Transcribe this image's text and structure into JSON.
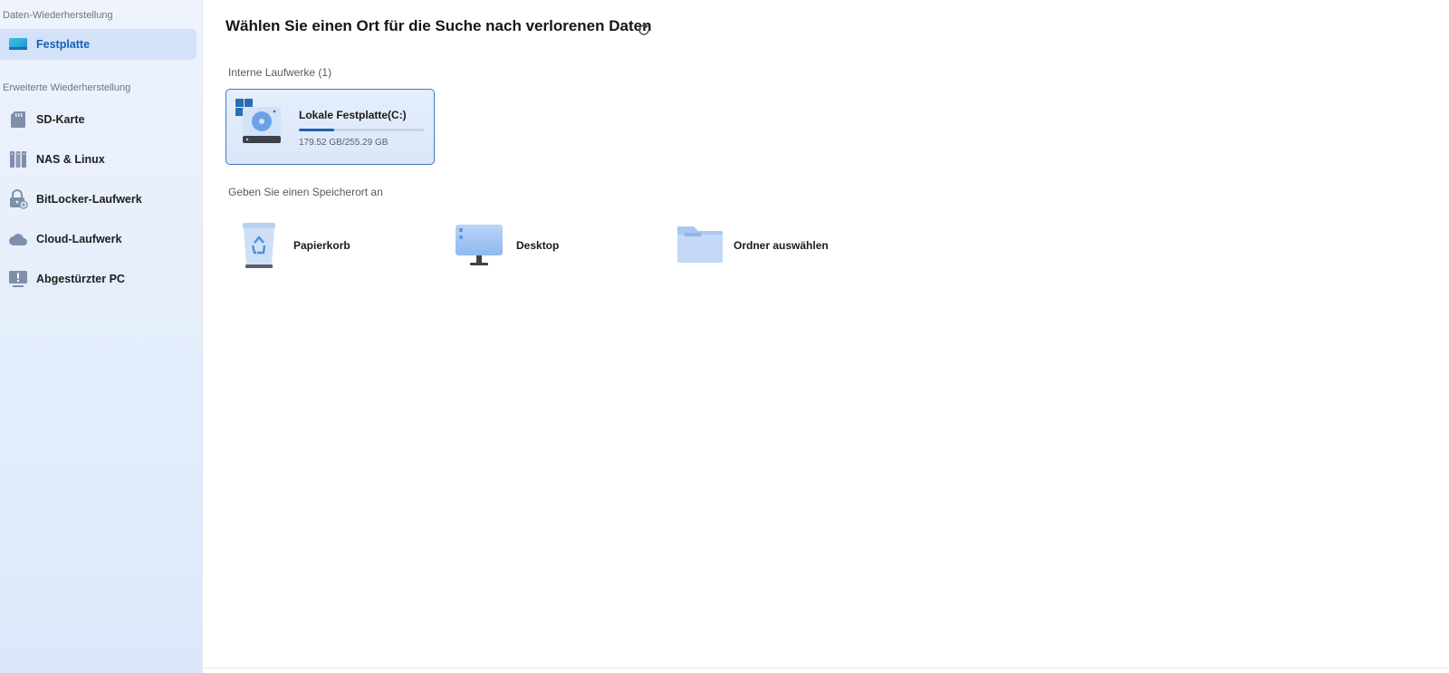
{
  "sidebar": {
    "section_recovery": "Daten-Wiederherstellung",
    "section_advanced": "Erweiterte Wiederherstellung",
    "items": [
      {
        "label": "Festplatte",
        "icon": "hard-disk-icon",
        "active": true
      },
      {
        "label": "SD-Karte",
        "icon": "sd-card-icon"
      },
      {
        "label": "NAS & Linux",
        "icon": "nas-icon"
      },
      {
        "label": "BitLocker-Laufwerk",
        "icon": "bitlocker-lock-icon"
      },
      {
        "label": "Cloud-Laufwerk",
        "icon": "cloud-icon"
      },
      {
        "label": "Abgestürzter PC",
        "icon": "crashed-pc-icon"
      }
    ]
  },
  "main": {
    "title": "Wählen Sie einen Ort für die Suche nach verlorenen Daten",
    "refresh_icon": "refresh-icon",
    "internal_drives_label": "Interne Laufwerke (1)",
    "drive": {
      "name": "Lokale Festplatte(C:)",
      "size_text": "179.52 GB/255.29 GB",
      "usage_percent": 28,
      "icon": "windows-drive-icon"
    },
    "location_label": "Geben Sie einen Speicherort an",
    "locations": [
      {
        "label": "Papierkorb",
        "icon": "recycle-bin-icon"
      },
      {
        "label": "Desktop",
        "icon": "desktop-monitor-icon"
      },
      {
        "label": "Ordner auswählen",
        "icon": "folder-icon"
      }
    ]
  },
  "colors": {
    "accent": "#1261b8",
    "active_bg": "#d3e2f8",
    "card_border": "#3b79c6"
  }
}
